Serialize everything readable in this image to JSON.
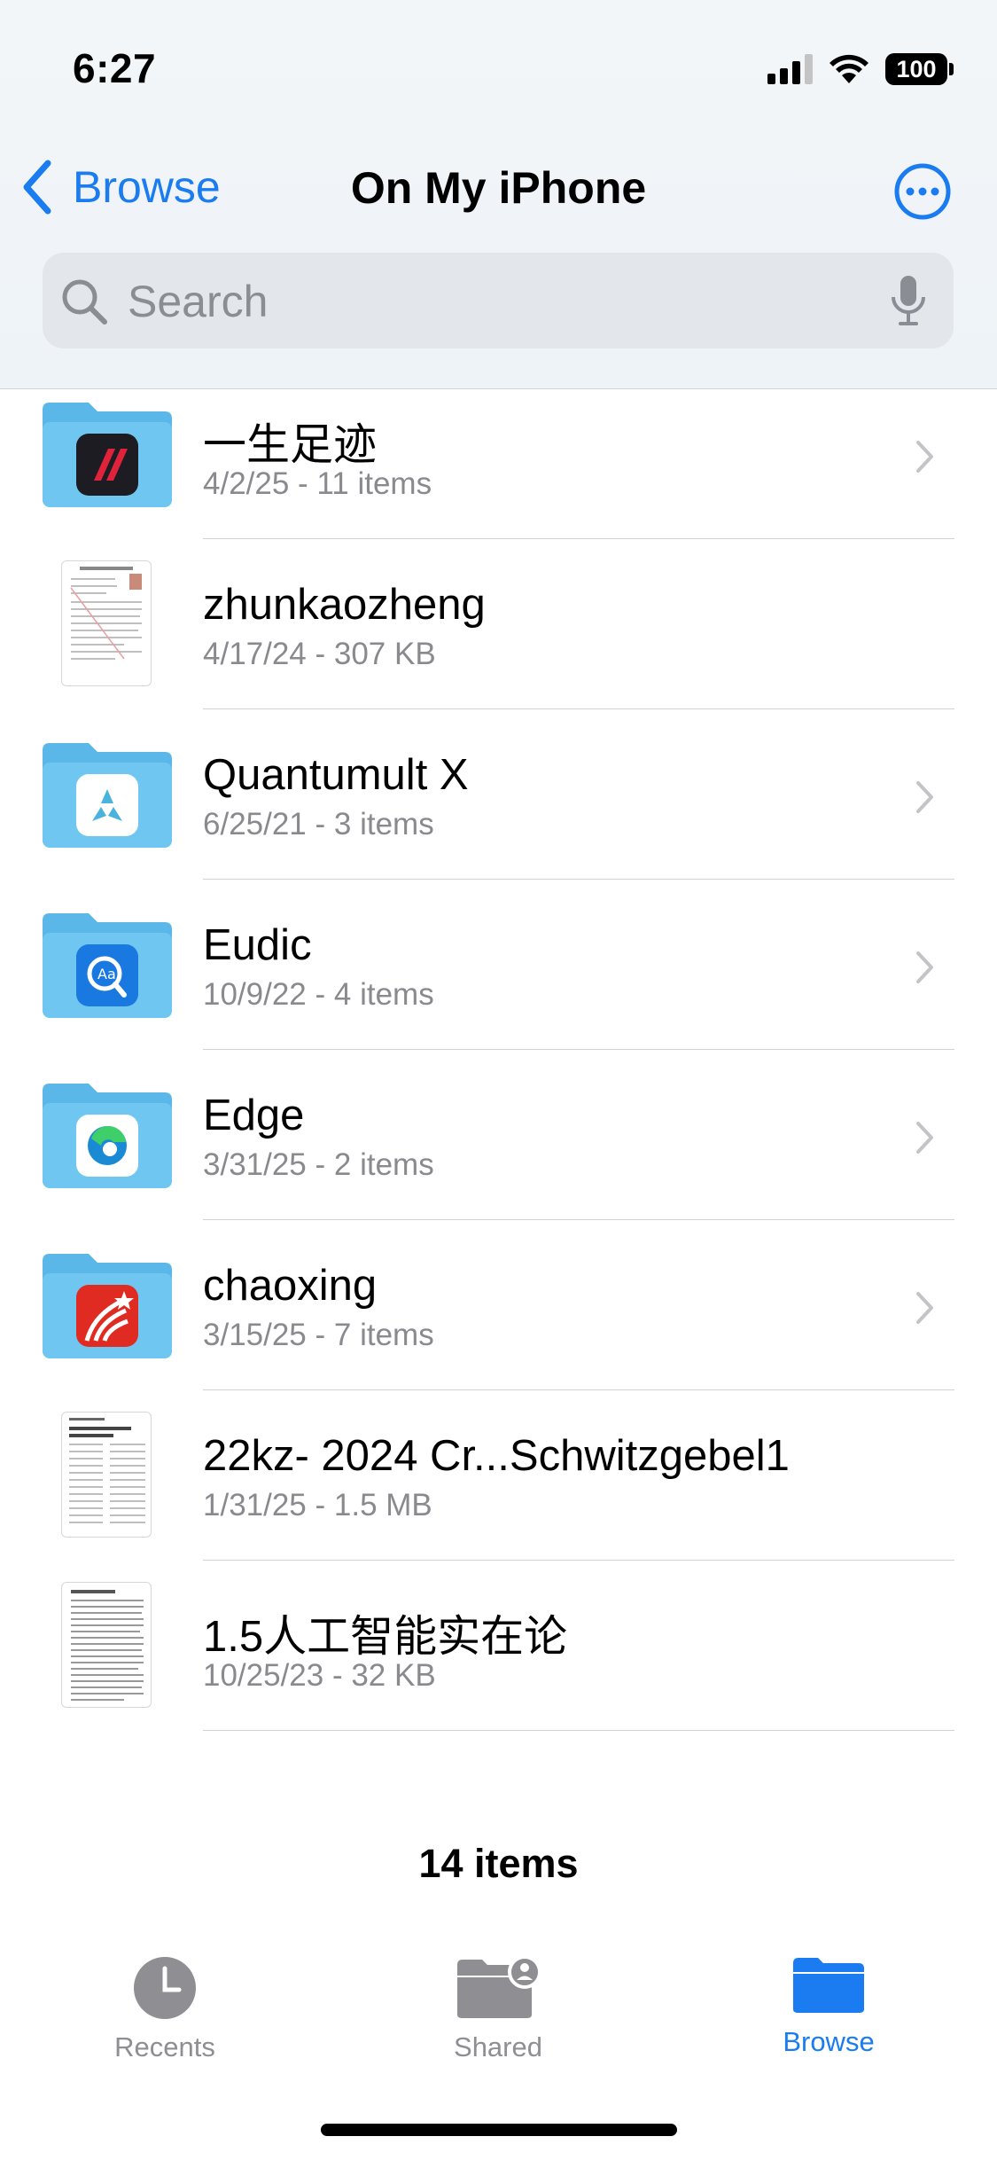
{
  "status_bar": {
    "time": "6:27",
    "battery": "100"
  },
  "nav": {
    "back_label": "Browse",
    "title": "On My iPhone"
  },
  "search": {
    "placeholder": "Search"
  },
  "items": [
    {
      "title": "一生足迹",
      "subtitle": "4/2/25 - 11 items",
      "kind": "folder",
      "app_icon": "footprint-app-icon"
    },
    {
      "title": "zhunkaozheng",
      "subtitle": "4/17/24 - 307 KB",
      "kind": "document"
    },
    {
      "title": "Quantumult X",
      "subtitle": "6/25/21 - 3 items",
      "kind": "folder",
      "app_icon": "quantumult-app-icon"
    },
    {
      "title": "Eudic",
      "subtitle": "10/9/22 - 4 items",
      "kind": "folder",
      "app_icon": "eudic-app-icon"
    },
    {
      "title": "Edge",
      "subtitle": "3/31/25 - 2 items",
      "kind": "folder",
      "app_icon": "edge-app-icon"
    },
    {
      "title": "chaoxing",
      "subtitle": "3/15/25 - 7 items",
      "kind": "folder",
      "app_icon": "chaoxing-app-icon"
    },
    {
      "title": "22kz- 2024 Cr...Schwitzgebel1",
      "subtitle": "1/31/25 - 1.5 MB",
      "kind": "document"
    },
    {
      "title": "1.5人工智能实在论",
      "subtitle": "10/25/23 - 32 KB",
      "kind": "document"
    }
  ],
  "footer": {
    "count": "14 items"
  },
  "tabs": {
    "recents": "Recents",
    "shared": "Shared",
    "browse": "Browse"
  },
  "colors": {
    "accent": "#1a7cf0",
    "folder": "#6ec6f1",
    "secondary_text": "#8a8a8e"
  }
}
